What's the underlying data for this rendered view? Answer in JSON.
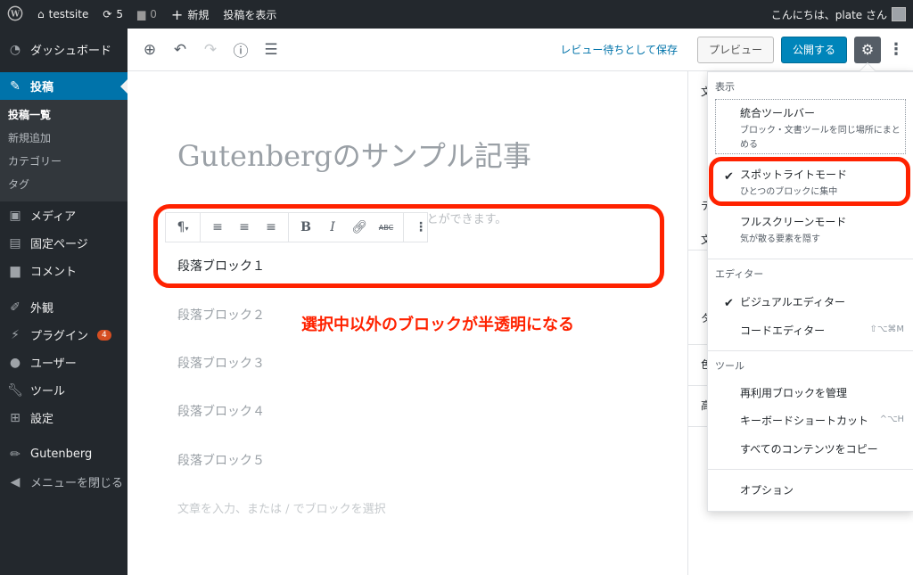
{
  "adminbar": {
    "site_name": "testsite",
    "updates_count": "5",
    "comments_count": "0",
    "new_label": "新規",
    "view_post": "投稿を表示",
    "greeting": "こんにちは、plate さん"
  },
  "sidebar": {
    "dashboard": "ダッシュボード",
    "posts": "投稿",
    "posts_sub": [
      "投稿一覧",
      "新規追加",
      "カテゴリー",
      "タグ"
    ],
    "media": "メディア",
    "pages": "固定ページ",
    "comments": "コメント",
    "appearance": "外観",
    "plugins": "プラグイン",
    "plugins_badge": "4",
    "users": "ユーザー",
    "tools": "ツール",
    "settings": "設定",
    "gutenberg": "Gutenberg",
    "collapse": "メニューを閉じる"
  },
  "toolbar": {
    "save_draft": "レビュー待ちとして保存",
    "preview": "プレビュー",
    "publish": "公開する"
  },
  "editor": {
    "title": "Gutenbergのサンプル記事",
    "intro_fragment": "いていくことができます。",
    "blocks": [
      "段落ブロック１",
      "段落ブロック２",
      "段落ブロック３",
      "段落ブロック４",
      "段落ブロック５"
    ],
    "placeholder": "文章を入力、または / でブロックを選択"
  },
  "annotation": "選択中以外のブロックが半透明になる",
  "right_panel": {
    "fragments": [
      "文",
      "テ",
      "文",
      "タ",
      "色",
      "高"
    ]
  },
  "menu": {
    "view_heading": "表示",
    "unified_toolbar": "統合ツールバー",
    "unified_toolbar_desc": "ブロック・文書ツールを同じ場所にまとめる",
    "spotlight": "スポットライトモード",
    "spotlight_desc": "ひとつのブロックに集中",
    "fullscreen": "フルスクリーンモード",
    "fullscreen_desc": "気が散る要素を隠す",
    "editor_heading": "エディター",
    "visual_editor": "ビジュアルエディター",
    "code_editor": "コードエディター",
    "code_editor_shortcut": "⇧⌥⌘M",
    "tools_heading": "ツール",
    "manage_reusable": "再利用ブロックを管理",
    "keyboard_shortcuts": "キーボードショートカット",
    "keyboard_shortcuts_shortcut": "^⌥H",
    "copy_all": "すべてのコンテンツをコピー",
    "options": "オプション"
  }
}
